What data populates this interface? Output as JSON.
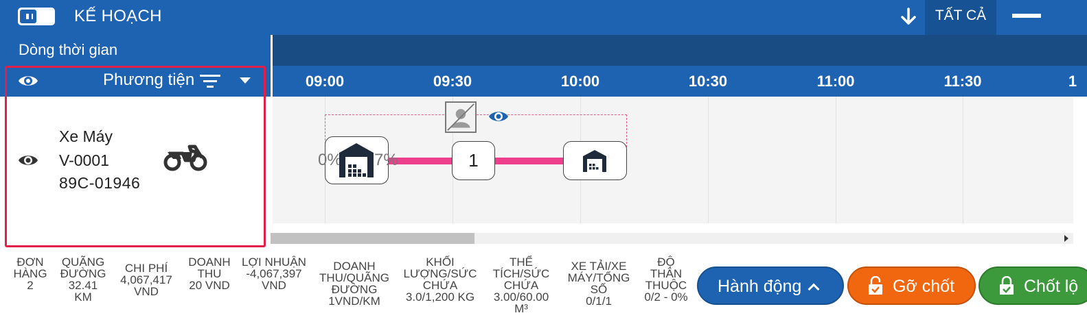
{
  "header": {
    "title": "KẾ HOẠCH",
    "filter_label": "TẤT CẢ",
    "icons": [
      "toggle-icon",
      "down-arrow-icon",
      "collapse-icon"
    ]
  },
  "timeline": {
    "section_label": "Dòng thời gian",
    "column_title": "Phương tiện",
    "ticks": [
      "09:00",
      "09:30",
      "10:00",
      "10:30",
      "11:00",
      "11:30",
      "1"
    ]
  },
  "vehicle": {
    "type": "Xe Máy",
    "code": "V-0001",
    "plate": "89C-01946",
    "icon": "motorcycle-icon"
  },
  "trip": {
    "start_pct": "0%",
    "end_pct": "7%",
    "stop_number": "1",
    "colors": {
      "route": "#ee3f8c",
      "highlight": "#e0204a"
    }
  },
  "stats": [
    {
      "label": "ĐƠN HÀNG",
      "value": "2"
    },
    {
      "label": "QUÃNG ĐƯỜNG",
      "value": "32.41 KM"
    },
    {
      "label": "CHI PHÍ",
      "value": "4,067,417 VND"
    },
    {
      "label": "DOANH THU",
      "value": "20 VND"
    },
    {
      "label": "LỢI NHUẬN",
      "value": "-4,067,397 VND"
    },
    {
      "label": "DOANH THU/QUÃNG ĐƯỜNG",
      "value": "1VND/KM"
    },
    {
      "label": "KHỐI LƯỢNG/SỨC CHỨA",
      "value": "3.0/1,200 KG"
    },
    {
      "label": "THỂ TÍCH/SỨC CHỨA",
      "value": "3.00/60.00 M³"
    },
    {
      "label": "XE TẢI/XE MÁY/TỔNG SỐ",
      "value": "0/1/1"
    },
    {
      "label": "ĐỘ THÂN THUỘC",
      "value": "0/2 - 0%"
    }
  ],
  "actions": {
    "action_label": "Hành động",
    "unlock_label": "Gỡ chốt",
    "lock_label": "Chốt lộ"
  }
}
